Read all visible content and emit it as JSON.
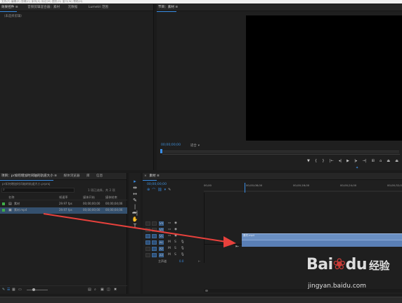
{
  "menubar": {
    "text": "文件(F)  编辑(E)  剪辑(C)  序列(S)  标记(M)  图形(G)  窗口(W)  帮助(H)"
  },
  "source_panel": {
    "tab": "效果控件 ≡",
    "tab2": "音频剪辑混合器：素材",
    "tab3": "元数据",
    "tab4": "Lumetri 范围",
    "subheader": "（未选择剪辑）"
  },
  "program_monitor": {
    "tab": "节目：素材 ≡",
    "timecode": "00;00;00;00",
    "fit": "适合",
    "controls": [
      "▼",
      "{",
      "}",
      "|←",
      "◂|",
      "▶",
      "|▸",
      "→|",
      "⊞",
      "⌂",
      "⏏",
      "⏏"
    ]
  },
  "project_panel": {
    "tab": "项目：pr如何增加时间轴的轨道大小 ≡",
    "tab2": "媒体浏览器",
    "tab3": "库",
    "tab4": "信息",
    "file": "pr如何增加时间轴的轨道大小.prproj",
    "search_placeholder": "",
    "selection": "1 项已选择，共 2 项",
    "columns": [
      "名称",
      "帧速率",
      "媒体开始",
      "媒体结束"
    ],
    "items": [
      {
        "name": "素材",
        "fps": "29.97 fps",
        "start": "00;00;00;00",
        "end": "00;00;04;06",
        "color": "#3fae49"
      },
      {
        "name": "素材.mp4",
        "fps": "29.97 fps",
        "start": "00;00;00;00",
        "end": "00;00;04;06",
        "color": "#3fae49"
      }
    ]
  },
  "tools": [
    "▸",
    "⇹",
    "↔",
    "✎",
    "|↔|",
    "✒",
    "✋",
    "T"
  ],
  "timeline": {
    "tab": "素材 ≡",
    "timecode": "00;00;00;00",
    "ruler": [
      "00;00",
      "00;00;08;00",
      "00;00;16;00",
      "00;00;24;00",
      "00;00;32;00"
    ],
    "tracks": [
      {
        "name": "V3",
        "kind": "video"
      },
      {
        "name": "V2",
        "kind": "video"
      },
      {
        "name": "V1",
        "kind": "video"
      },
      {
        "name": "A1",
        "kind": "audio"
      },
      {
        "name": "A2",
        "kind": "audio"
      },
      {
        "name": "A3",
        "kind": "audio"
      }
    ],
    "master_label": "主声道",
    "master_value": "0.0",
    "clip_label": "素材.mp4"
  },
  "watermark": {
    "brand": "Bai",
    "paw": "du",
    "cn": "经验",
    "url": "jingyan.baidu.com"
  },
  "colors": {
    "accent": "#3a8ee6",
    "clip_video": "#6a8fc2",
    "arrow": "#e8413c",
    "label_green": "#3fae49"
  }
}
